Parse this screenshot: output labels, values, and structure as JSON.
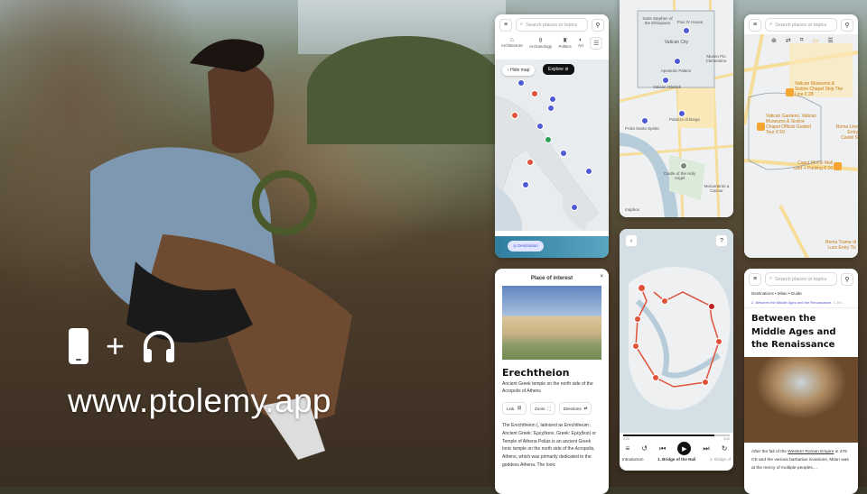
{
  "promo": {
    "url": "www.ptolemy.app",
    "icons": [
      "smartphone-icon",
      "plus-icon",
      "headphones-icon"
    ],
    "plus": "+"
  },
  "search": {
    "placeholder": "Search places or topics"
  },
  "europe": {
    "categories": [
      "Architecture",
      "Archaeology",
      "Politics",
      "Art"
    ],
    "hide_map": "Hide map",
    "explore": "Explore",
    "destination": "Destination"
  },
  "poi": {
    "header": "Place of interest",
    "title": "Erechtheion",
    "subtitle": "Ancient Greek temple on the north side of the Acropolis of Athens",
    "actions": [
      "Link",
      "Zoom",
      "Directions"
    ],
    "body": "The Erechtheion (, latinized as Erechtheum ; Ancient Greek: Ἐρέχθειον, Greek: Ερέχθειο) or Temple of Athena Polias is an ancient Greek Ionic temple on the north side of the Acropolis, Athens, which was primarily dedicated to the goddess Athena. The Ionic"
  },
  "vatican": {
    "labels": [
      "Saint Stephen of the Ethiopians",
      "Pius IV House",
      "Vatican City",
      "Museo Pio Clementino",
      "Apostolic Palace",
      "Vatican Obelisk",
      "Porta Santo Spirito",
      "Palazzo di Borgo",
      "Castle of the Holy Angel",
      "Monumento a Cavour"
    ],
    "attribution": "mapbox"
  },
  "venice": {
    "stops": [
      "1",
      "2",
      "3",
      "4",
      "5",
      "6",
      "7",
      "8",
      "9",
      "10",
      "11",
      "12",
      "13"
    ],
    "times": [
      "0:00",
      "5:42"
    ],
    "progress": 0.0,
    "tracks": [
      "Introduction",
      "1. Bridge of the Nail",
      "2. Bridge of"
    ]
  },
  "rome": {
    "tours": [
      {
        "name": "Vatican Museums & Sistine Chapel Skip The Line",
        "price": "€ 28"
      },
      {
        "name": "Vatican Gardens, Vatican Museums & Sistine Chapel Official Guided Tour",
        "price": "€ 50"
      },
      {
        "name": "Roma Line Entry Castel S",
        "price": ""
      },
      {
        "name": "Caput Mundi Mall card + Parking",
        "price": "€ 10"
      },
      {
        "name": "Roma Trame di Luce Entry Tic",
        "price": ""
      }
    ]
  },
  "guide": {
    "breadcrumb": [
      "Destinations",
      "Milan",
      "Guide"
    ],
    "chapter": "2. Between the Middle Ages and the Renaissance",
    "next": "4. Be...",
    "title": "Between the Middle Ages and the Renaissance",
    "body_pre": "After the fall of the ",
    "link": "Western Roman Empire",
    "body_post": " in 476 CE and the various barbarian invasions, Milan was at the mercy of multiple peoples,..."
  },
  "colors": {
    "accent": "#4f5bd5",
    "route": "#e0523a",
    "orange": "#f7a531"
  }
}
